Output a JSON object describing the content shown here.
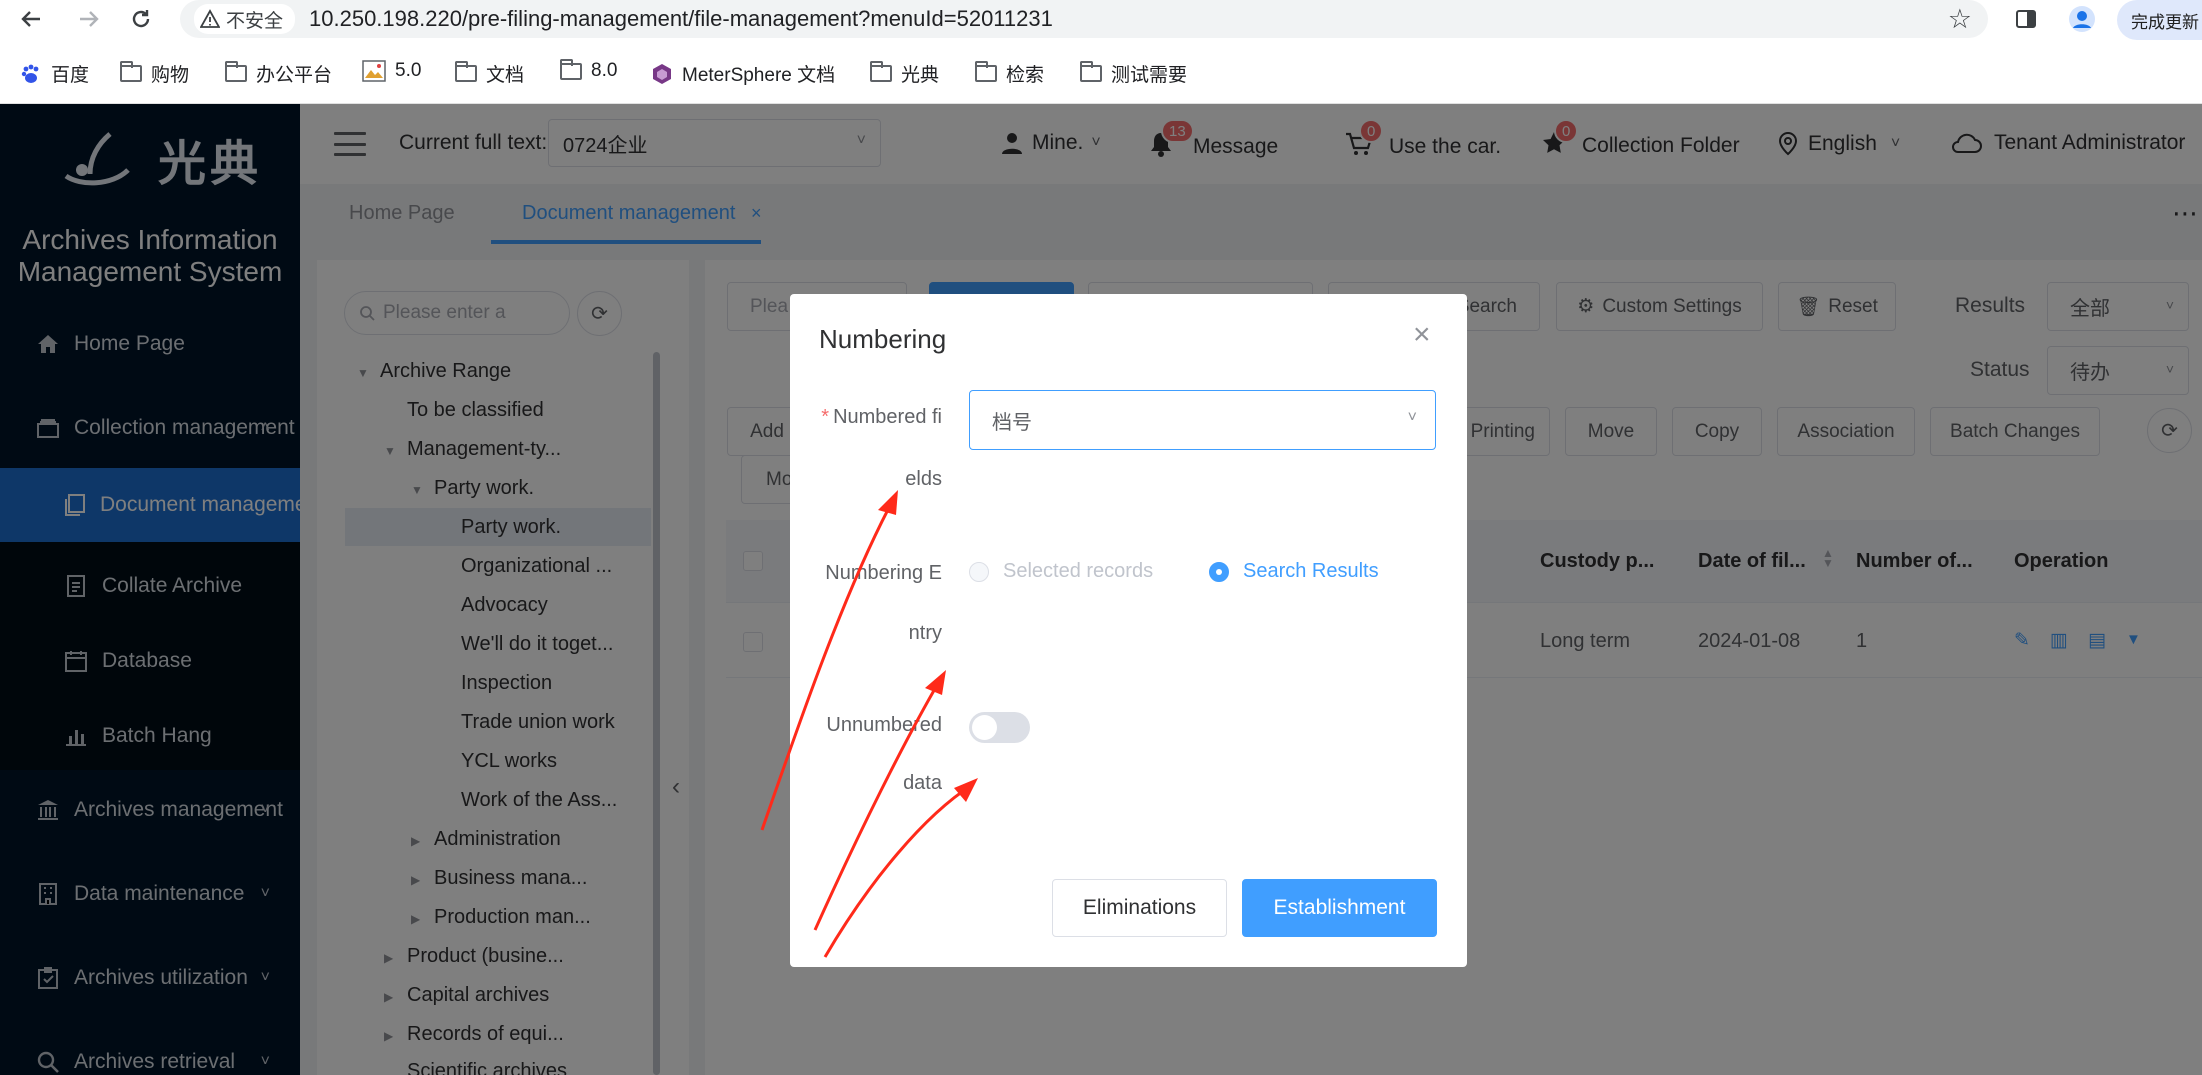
{
  "browser": {
    "insecure_label": "不安全",
    "url": "10.250.198.220/pre-filing-management/file-management?menuId=52011231",
    "update_label": "完成更新",
    "bookmarks": [
      {
        "label": "百度",
        "icon": "baidu-paw-icon"
      },
      {
        "label": "购物",
        "icon": "folder-icon"
      },
      {
        "label": "办公平台",
        "icon": "folder-icon"
      },
      {
        "label": "5.0",
        "icon": "image-icon"
      },
      {
        "label": "文档",
        "icon": "folder-icon"
      },
      {
        "label": "8.0",
        "icon": "folder-icon"
      },
      {
        "label": "MeterSphere 文档",
        "icon": "metersphere-icon"
      },
      {
        "label": "光典",
        "icon": "folder-icon"
      },
      {
        "label": "检索",
        "icon": "folder-icon"
      },
      {
        "label": "测试需要",
        "icon": "folder-icon"
      }
    ]
  },
  "sidebar": {
    "logo_text": "光典",
    "system_title_line1": "Archives Information",
    "system_title_line2": "Management System",
    "items": [
      {
        "label": "Home Page",
        "icon": "home-icon"
      },
      {
        "label": "Collection management",
        "icon": "inbox-icon"
      },
      {
        "label": "Document manageme",
        "icon": "documents-icon"
      },
      {
        "label": "Collate Archive",
        "icon": "file-icon"
      },
      {
        "label": "Database",
        "icon": "calendar-icon"
      },
      {
        "label": "Batch Hang",
        "icon": "bar-chart-icon"
      },
      {
        "label": "Archives management",
        "icon": "bank-icon"
      },
      {
        "label": "Data maintenance",
        "icon": "building-icon"
      },
      {
        "label": "Archives utilization",
        "icon": "clipboard-check-icon"
      },
      {
        "label": "Archives retrieval",
        "icon": "search-icon"
      }
    ]
  },
  "header": {
    "current_full_text_label": "Current full text:",
    "current_full_text_value": "0724企业",
    "mine_label": "Mine.",
    "message_label": "Message",
    "message_count": "13",
    "car_label": "Use the car.",
    "car_count": "0",
    "collection_label": "Collection Folder",
    "collection_count": "0",
    "language_label": "English",
    "tenant_label": "Tenant Administrator"
  },
  "tabs": {
    "home": "Home Page",
    "document": "Document management",
    "close": "×"
  },
  "tree": {
    "search_placeholder": "Please enter a",
    "nodes": [
      "Archive Range",
      "To be classified",
      "Management-ty...",
      "Party work.",
      "Party work.",
      "Organizational ...",
      "Advocacy",
      "We'll do it toget...",
      "Inspection",
      "Trade union work",
      "YCL works",
      "Work of the Ass...",
      "Administration",
      "Business mana...",
      "Production man...",
      "Product (busine...",
      "Capital archives",
      "Records of equi...",
      "Scientific archives"
    ]
  },
  "toolbar": {
    "search_placeholder": "Plea",
    "search_label": "Search",
    "custom_settings_label": "Custom Settings",
    "reset_label": "Reset",
    "results_label": "Results",
    "results_value": "全部",
    "status_label": "Status",
    "status_value": "待办",
    "add_label": "Add",
    "mo_label": "Mo",
    "printing_label": "Printing",
    "move_label": "Move",
    "copy_label": "Copy",
    "association_label": "Association",
    "batch_changes_label": "Batch Changes"
  },
  "table": {
    "headers": [
      "Custody p...",
      "Date of fil...",
      "Number of...",
      "Operation"
    ],
    "rows": [
      {
        "custody": "Long term",
        "date": "2024-01-08",
        "number": "1"
      }
    ]
  },
  "dialog": {
    "title": "Numbering",
    "required_mark": "*",
    "numbered_fields_label_a": "Numbered fi",
    "numbered_fields_label_b": "elds",
    "numbered_fields_value": "档号",
    "numbering_entry_label_a": "Numbering E",
    "numbering_entry_label_b": "ntry",
    "radio_selected_records": "Selected records",
    "radio_search_results": "Search Results",
    "unnumbered_label_a": "Unnumbered",
    "unnumbered_label_b": "data",
    "unnumbered_on": false,
    "cancel_label": "Eliminations",
    "ok_label": "Establishment"
  },
  "colors": {
    "primary": "#409eff",
    "sidebar_bg": "#001529",
    "sidebar_active": "#1d6ed1",
    "badge": "#f56c6c",
    "annotation_arrow": "#ff2a1a"
  }
}
